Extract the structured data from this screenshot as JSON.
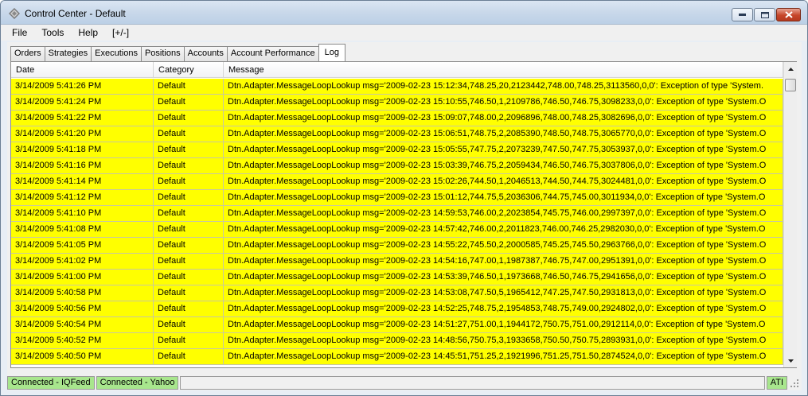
{
  "window": {
    "title": "Control Center - Default"
  },
  "menu": {
    "items": [
      "File",
      "Tools",
      "Help",
      "[+/-]"
    ]
  },
  "tabs": {
    "items": [
      "Orders",
      "Strategies",
      "Executions",
      "Positions",
      "Accounts",
      "Account Performance",
      "Log"
    ],
    "active": "Log"
  },
  "log": {
    "columns": {
      "date": "Date",
      "category": "Category",
      "message": "Message"
    },
    "row_color": "#ffff00",
    "rows": [
      {
        "date": "3/14/2009 5:41:26 PM",
        "category": "Default",
        "message": "Dtn.Adapter.MessageLoopLookup msg='2009-02-23  15:12:34,748.25,20,2123442,748.00,748.25,3113560,0,0': Exception of type 'System."
      },
      {
        "date": "3/14/2009 5:41:24 PM",
        "category": "Default",
        "message": "Dtn.Adapter.MessageLoopLookup msg='2009-02-23  15:10:55,746.50,1,2109786,746.50,746.75,3098233,0,0': Exception of type 'System.O"
      },
      {
        "date": "3/14/2009 5:41:22 PM",
        "category": "Default",
        "message": "Dtn.Adapter.MessageLoopLookup msg='2009-02-23  15:09:07,748.00,2,2096896,748.00,748.25,3082696,0,0': Exception of type 'System.O"
      },
      {
        "date": "3/14/2009 5:41:20 PM",
        "category": "Default",
        "message": "Dtn.Adapter.MessageLoopLookup msg='2009-02-23  15:06:51,748.75,2,2085390,748.50,748.75,3065770,0,0': Exception of type 'System.O"
      },
      {
        "date": "3/14/2009 5:41:18 PM",
        "category": "Default",
        "message": "Dtn.Adapter.MessageLoopLookup msg='2009-02-23  15:05:55,747.75,2,2073239,747.50,747.75,3053937,0,0': Exception of type 'System.O"
      },
      {
        "date": "3/14/2009 5:41:16 PM",
        "category": "Default",
        "message": "Dtn.Adapter.MessageLoopLookup msg='2009-02-23  15:03:39,746.75,2,2059434,746.50,746.75,3037806,0,0': Exception of type 'System.O"
      },
      {
        "date": "3/14/2009 5:41:14 PM",
        "category": "Default",
        "message": "Dtn.Adapter.MessageLoopLookup msg='2009-02-23  15:02:26,744.50,1,2046513,744.50,744.75,3024481,0,0': Exception of type 'System.O"
      },
      {
        "date": "3/14/2009 5:41:12 PM",
        "category": "Default",
        "message": "Dtn.Adapter.MessageLoopLookup msg='2009-02-23  15:01:12,744.75,5,2036306,744.75,745.00,3011934,0,0': Exception of type 'System.O"
      },
      {
        "date": "3/14/2009 5:41:10 PM",
        "category": "Default",
        "message": "Dtn.Adapter.MessageLoopLookup msg='2009-02-23  14:59:53,746.00,2,2023854,745.75,746.00,2997397,0,0': Exception of type 'System.O"
      },
      {
        "date": "3/14/2009 5:41:08 PM",
        "category": "Default",
        "message": "Dtn.Adapter.MessageLoopLookup msg='2009-02-23  14:57:42,746.00,2,2011823,746.00,746.25,2982030,0,0': Exception of type 'System.O"
      },
      {
        "date": "3/14/2009 5:41:05 PM",
        "category": "Default",
        "message": "Dtn.Adapter.MessageLoopLookup msg='2009-02-23  14:55:22,745.50,2,2000585,745.25,745.50,2963766,0,0': Exception of type 'System.O"
      },
      {
        "date": "3/14/2009 5:41:02 PM",
        "category": "Default",
        "message": "Dtn.Adapter.MessageLoopLookup msg='2009-02-23  14:54:16,747.00,1,1987387,746.75,747.00,2951391,0,0': Exception of type 'System.O"
      },
      {
        "date": "3/14/2009 5:41:00 PM",
        "category": "Default",
        "message": "Dtn.Adapter.MessageLoopLookup msg='2009-02-23  14:53:39,746.50,1,1973668,746.50,746.75,2941656,0,0': Exception of type 'System.O"
      },
      {
        "date": "3/14/2009 5:40:58 PM",
        "category": "Default",
        "message": "Dtn.Adapter.MessageLoopLookup msg='2009-02-23  14:53:08,747.50,5,1965412,747.25,747.50,2931813,0,0': Exception of type 'System.O"
      },
      {
        "date": "3/14/2009 5:40:56 PM",
        "category": "Default",
        "message": "Dtn.Adapter.MessageLoopLookup msg='2009-02-23  14:52:25,748.75,2,1954853,748.75,749.00,2924802,0,0': Exception of type 'System.O"
      },
      {
        "date": "3/14/2009 5:40:54 PM",
        "category": "Default",
        "message": "Dtn.Adapter.MessageLoopLookup msg='2009-02-23  14:51:27,751.00,1,1944172,750.75,751.00,2912114,0,0': Exception of type 'System.O"
      },
      {
        "date": "3/14/2009 5:40:52 PM",
        "category": "Default",
        "message": "Dtn.Adapter.MessageLoopLookup msg='2009-02-23  14:48:56,750.75,3,1933658,750.50,750.75,2893931,0,0': Exception of type 'System.O"
      },
      {
        "date": "3/14/2009 5:40:50 PM",
        "category": "Default",
        "message": "Dtn.Adapter.MessageLoopLookup msg='2009-02-23  14:45:51,751.25,2,1921996,751.25,751.50,2874524,0,0': Exception of type 'System.O"
      }
    ]
  },
  "status": {
    "iqfeed": "Connected - IQFeed",
    "yahoo": "Connected - Yahoo",
    "ati": "ATI",
    "ok_color": "#a8e68d"
  }
}
